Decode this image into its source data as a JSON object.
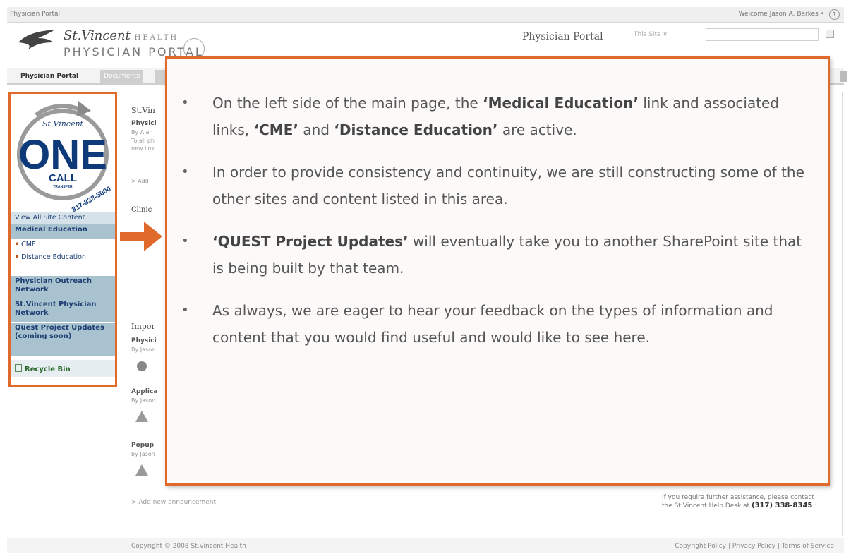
{
  "window": {
    "breadcrumb": "Physician Portal",
    "welcome": "Welcome Jason A. Barkes •",
    "help_icon": "help-icon"
  },
  "header": {
    "brand_line1": "St.Vincent",
    "brand_health": "HEALTH",
    "brand_line2": "PHYSICIAN PORTAL",
    "portal_title": "Physician Portal",
    "search_scope": "This Site ∨"
  },
  "nav": {
    "tab_active": "Physician Portal",
    "tab_documents": "Documents"
  },
  "leftnav": {
    "logo_brand": "St.Vincent",
    "logo_one": "ONE",
    "logo_call": "CALL",
    "logo_transfer": "TRANSFER",
    "logo_phone": "317-338-5000",
    "view_all": "View All Site Content",
    "medical_education": "Medical Education",
    "cme": "CME",
    "distance_education": "Distance Education",
    "outreach": "Physician Outreach Network",
    "svpn": "St.Vincent Physician Network",
    "quest": "Quest Project Updates (coming soon)",
    "recycle": "Recycle Bin"
  },
  "main": {
    "frag_title": "St.Vin",
    "frag_physi": "Physici",
    "frag_by": "By Alan",
    "frag_toall": "To all ph",
    "frag_newlink": "new link",
    "frag_add1": "> Add",
    "frag_clinic": "Clinic",
    "frag_impor": "Impor",
    "frag_phys2": "Physici",
    "frag_by2": "By Jason",
    "frag_applic": "Applica",
    "frag_by3": "By Jason",
    "frag_popup": "Popup",
    "frag_by4": "by Jason",
    "add_announcement": "> Add new announcement",
    "help_text": "If you require further assistance, please contact the St.Vincent Help Desk at",
    "help_phone": "(317) 338-8345"
  },
  "footer": {
    "copyright": "Copyright © 2008 St.Vincent Health",
    "policy": "Copyright Policy | Privacy Policy | Terms of Service"
  },
  "callout": {
    "b1_pre": "On the left side of the main page, the ",
    "b1_bold1": "‘Medical Education’",
    "b1_mid": " link and associated links, ",
    "b1_bold2": "‘CME’",
    "b1_and": " and ",
    "b1_bold3": "‘Distance Education’",
    "b1_post": " are active.",
    "b2": "In order to provide consistency and continuity, we are still constructing some of the other sites and content listed in this area.",
    "b3_bold": "‘QUEST Project Updates’",
    "b3_post": " will eventually take you to another SharePoint site that is being built by that team.",
    "b4": "As always, we are eager to hear your feedback on the types of information and content that you would find useful and would like to see here."
  },
  "colors": {
    "accent_orange": "#e06a2c",
    "nav_blue": "#1e3f74",
    "nav_bg": "#a9c2cf"
  }
}
